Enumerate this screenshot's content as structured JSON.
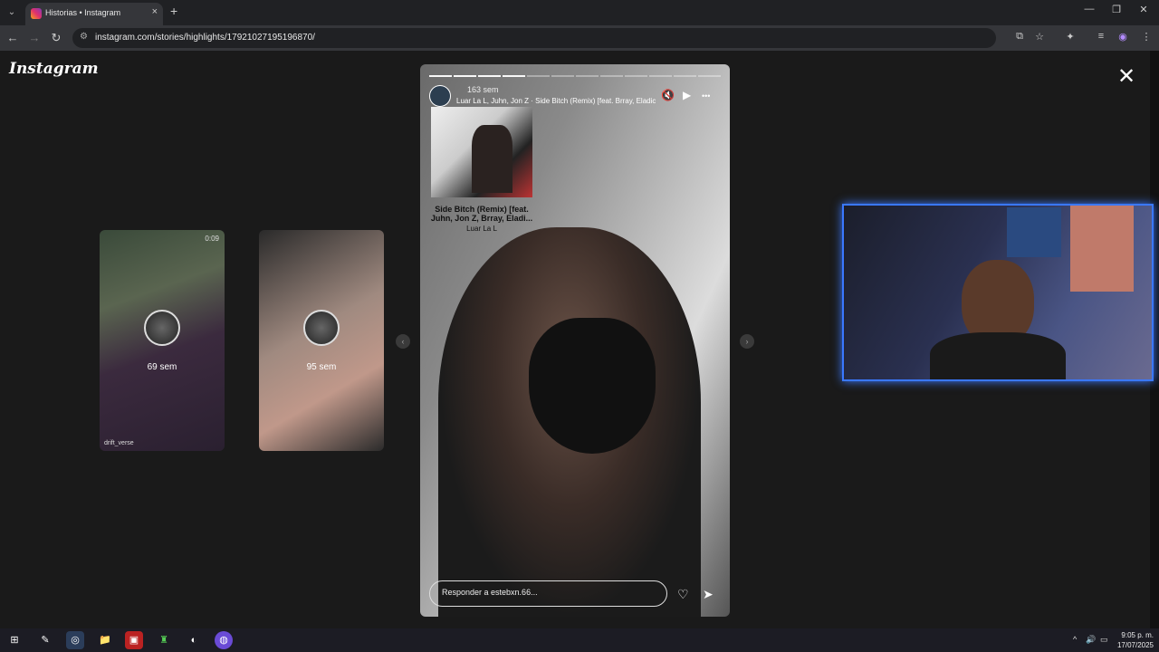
{
  "browser": {
    "tab_title": "Historias • Instagram",
    "url": "instagram.com/stories/highlights/17921027195196870/",
    "new_tab_label": "+",
    "tab_close": "×",
    "tab_list": "⌄",
    "back": "←",
    "forward": "→",
    "reload": "↻",
    "site_info": "⚙",
    "minimize": "—",
    "restore": "❐",
    "close": "✕",
    "cast": "⧉",
    "bookmark": "☆",
    "extensions": "✦",
    "media": "≡",
    "profile": "◉",
    "menu": "⋮"
  },
  "page": {
    "logo_text": "Instagram",
    "close_label": "✕"
  },
  "side_stories": [
    {
      "time": "69 sem",
      "duration": "0:09",
      "user": "drift_verse"
    },
    {
      "time": "95 sem"
    }
  ],
  "nav": {
    "prev": "‹",
    "next": "›"
  },
  "story": {
    "time_ago": "163 sem",
    "music": "Luar La L, Juhn, Jon Z · Side Bitch (Remix) [feat. Brray, Eladic",
    "mute_icon": "🔇",
    "play_icon": "▶",
    "more_icon": "•••",
    "song_title": "Side Bitch (Remix) [feat. Juhn, Jon Z, Brray, Eladi...",
    "song_artist": "Luar La L",
    "reply_placeholder": "Responder a estebxn.66...",
    "like_icon": "♡",
    "share_icon": "➤",
    "segments_total": 12,
    "segments_done": 4
  },
  "taskbar": {
    "start": "⊞",
    "apps": [
      "✎",
      "◎",
      "📁",
      "▣",
      "♜",
      "◐",
      "◍"
    ],
    "tray_icons": [
      "^",
      "🔊",
      "▭",
      "📶"
    ],
    "time": "9:05 p. m.",
    "date": "17/07/2025"
  }
}
